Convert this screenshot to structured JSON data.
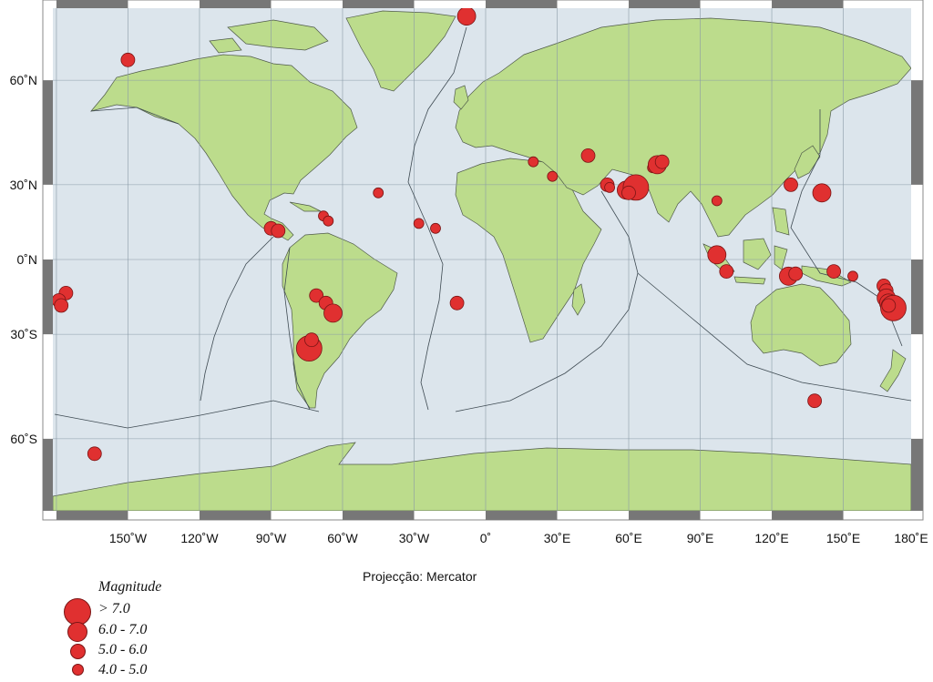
{
  "map": {
    "projection_label": "Projecção: Mercator",
    "colors": {
      "ocean": "#dce5ec",
      "land": "#bcdc8c",
      "event": "#e03030",
      "grid": "#8a9aa6",
      "frame": "#777777"
    },
    "lon_labels": [
      {
        "lon": -150,
        "text": "150˚W"
      },
      {
        "lon": -120,
        "text": "120˚W"
      },
      {
        "lon": -90,
        "text": "90˚W"
      },
      {
        "lon": -60,
        "text": "60˚W"
      },
      {
        "lon": -30,
        "text": "30˚W"
      },
      {
        "lon": 0,
        "text": "0˚"
      },
      {
        "lon": 30,
        "text": "30˚E"
      },
      {
        "lon": 60,
        "text": "60˚E"
      },
      {
        "lon": 90,
        "text": "90˚E"
      },
      {
        "lon": 120,
        "text": "120˚E"
      },
      {
        "lon": 150,
        "text": "150˚E"
      },
      {
        "lon": 180,
        "text": "180˚E"
      }
    ],
    "lat_labels": [
      {
        "lat": 60,
        "text": "60˚N"
      },
      {
        "lat": 30,
        "text": "30˚N"
      },
      {
        "lat": 0,
        "text": "0˚N"
      },
      {
        "lat": -30,
        "text": "30˚S"
      },
      {
        "lat": -60,
        "text": "60˚S"
      }
    ]
  },
  "legend": {
    "title": "Magnitude",
    "items": [
      {
        "label": "> 7.0",
        "class": "gt7"
      },
      {
        "label": "6.0 - 7.0",
        "class": "6to7"
      },
      {
        "label": "5.0 - 6.0",
        "class": "5to6"
      },
      {
        "label": "4.0 - 5.0",
        "class": "4to5"
      }
    ]
  },
  "events": [
    {
      "lon": -150,
      "lat": 64,
      "class": "5to6"
    },
    {
      "lon": -8,
      "lat": 71,
      "class": "6to7"
    },
    {
      "lon": -90,
      "lat": 13,
      "class": "5to6"
    },
    {
      "lon": -87,
      "lat": 12,
      "class": "5to6"
    },
    {
      "lon": -68,
      "lat": 18,
      "class": "4to5"
    },
    {
      "lon": -66,
      "lat": 16,
      "class": "4to5"
    },
    {
      "lon": -45,
      "lat": 27,
      "class": "4to5"
    },
    {
      "lon": -28,
      "lat": 15,
      "class": "4to5"
    },
    {
      "lon": -21,
      "lat": 13,
      "class": "4to5"
    },
    {
      "lon": -12,
      "lat": -18,
      "class": "5to6"
    },
    {
      "lon": -71,
      "lat": -15,
      "class": "5to6"
    },
    {
      "lon": -67,
      "lat": -18,
      "class": "5to6"
    },
    {
      "lon": -64,
      "lat": -22,
      "class": "6to7"
    },
    {
      "lon": -74,
      "lat": -35,
      "class": "gt7"
    },
    {
      "lon": -73,
      "lat": -32,
      "class": "5to6"
    },
    {
      "lon": -164,
      "lat": -63,
      "class": "5to6"
    },
    {
      "lon": -176,
      "lat": -14,
      "class": "5to6"
    },
    {
      "lon": -179,
      "lat": -17,
      "class": "5to6"
    },
    {
      "lon": -178,
      "lat": -19,
      "class": "5to6"
    },
    {
      "lon": 20,
      "lat": 38,
      "class": "4to5"
    },
    {
      "lon": 28,
      "lat": 33,
      "class": "4to5"
    },
    {
      "lon": 43,
      "lat": 40,
      "class": "5to6"
    },
    {
      "lon": 51,
      "lat": 30,
      "class": "5to6"
    },
    {
      "lon": 52,
      "lat": 29,
      "class": "4to5"
    },
    {
      "lon": 59,
      "lat": 28,
      "class": "6to7"
    },
    {
      "lon": 63,
      "lat": 29,
      "class": "gt7"
    },
    {
      "lon": 60,
      "lat": 27,
      "class": "5to6"
    },
    {
      "lon": 70,
      "lat": 36,
      "class": "4to5"
    },
    {
      "lon": 72,
      "lat": 37,
      "class": "6to7"
    },
    {
      "lon": 74,
      "lat": 38,
      "class": "5to6"
    },
    {
      "lon": 97,
      "lat": 24,
      "class": "4to5"
    },
    {
      "lon": 97,
      "lat": 2,
      "class": "6to7"
    },
    {
      "lon": 101,
      "lat": -5,
      "class": "5to6"
    },
    {
      "lon": 128,
      "lat": 30,
      "class": "5to6"
    },
    {
      "lon": 141,
      "lat": 27,
      "class": "6to7"
    },
    {
      "lon": 127,
      "lat": -7,
      "class": "6to7"
    },
    {
      "lon": 130,
      "lat": -6,
      "class": "5to6"
    },
    {
      "lon": 146,
      "lat": -5,
      "class": "5to6"
    },
    {
      "lon": 154,
      "lat": -7,
      "class": "4to5"
    },
    {
      "lon": 167,
      "lat": -11,
      "class": "5to6"
    },
    {
      "lon": 168,
      "lat": -13,
      "class": "5to6"
    },
    {
      "lon": 168,
      "lat": -16,
      "class": "6to7"
    },
    {
      "lon": 169,
      "lat": -18,
      "class": "6to7"
    },
    {
      "lon": 171,
      "lat": -20,
      "class": "gt7"
    },
    {
      "lon": 169,
      "lat": -19,
      "class": "5to6"
    },
    {
      "lon": 138,
      "lat": -51,
      "class": "5to6"
    }
  ]
}
